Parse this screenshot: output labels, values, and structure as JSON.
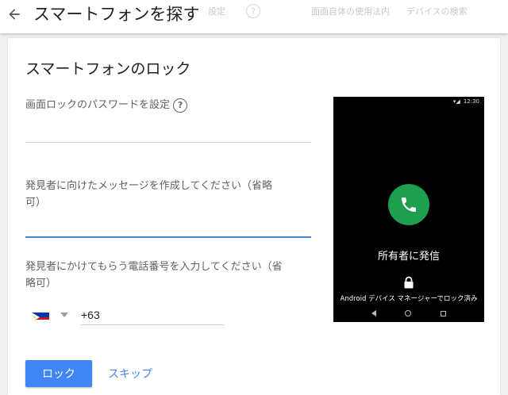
{
  "header": {
    "title": "スマートフォンを探す",
    "ghost_left": "設定",
    "ghost_mid": "面面自体の使用法内",
    "ghost_right": "デバイスの検索"
  },
  "card": {
    "title": "スマートフォンのロック",
    "password_label": "画面ロックのパスワードを設定",
    "password_value": "",
    "message_label_line1": "発見者に向けたメッセージを作成してください（省略",
    "message_label_line2": "可）",
    "message_value": "",
    "phone_label_line1": "発見者にかけてもらう電話番号を入力してください（省",
    "phone_label_line2": "略可）",
    "phone_value": "+63",
    "country": "Philippines",
    "lock_button": "ロック",
    "skip_link": "スキップ"
  },
  "preview": {
    "time": "12:30",
    "call_label": "所有者に発信",
    "locked_text": "Android デバイス マネージャーでロック済み"
  },
  "colors": {
    "accent": "#4285f4",
    "call_green": "#1e9e4f",
    "focus_underline": "#4a7fc9"
  }
}
